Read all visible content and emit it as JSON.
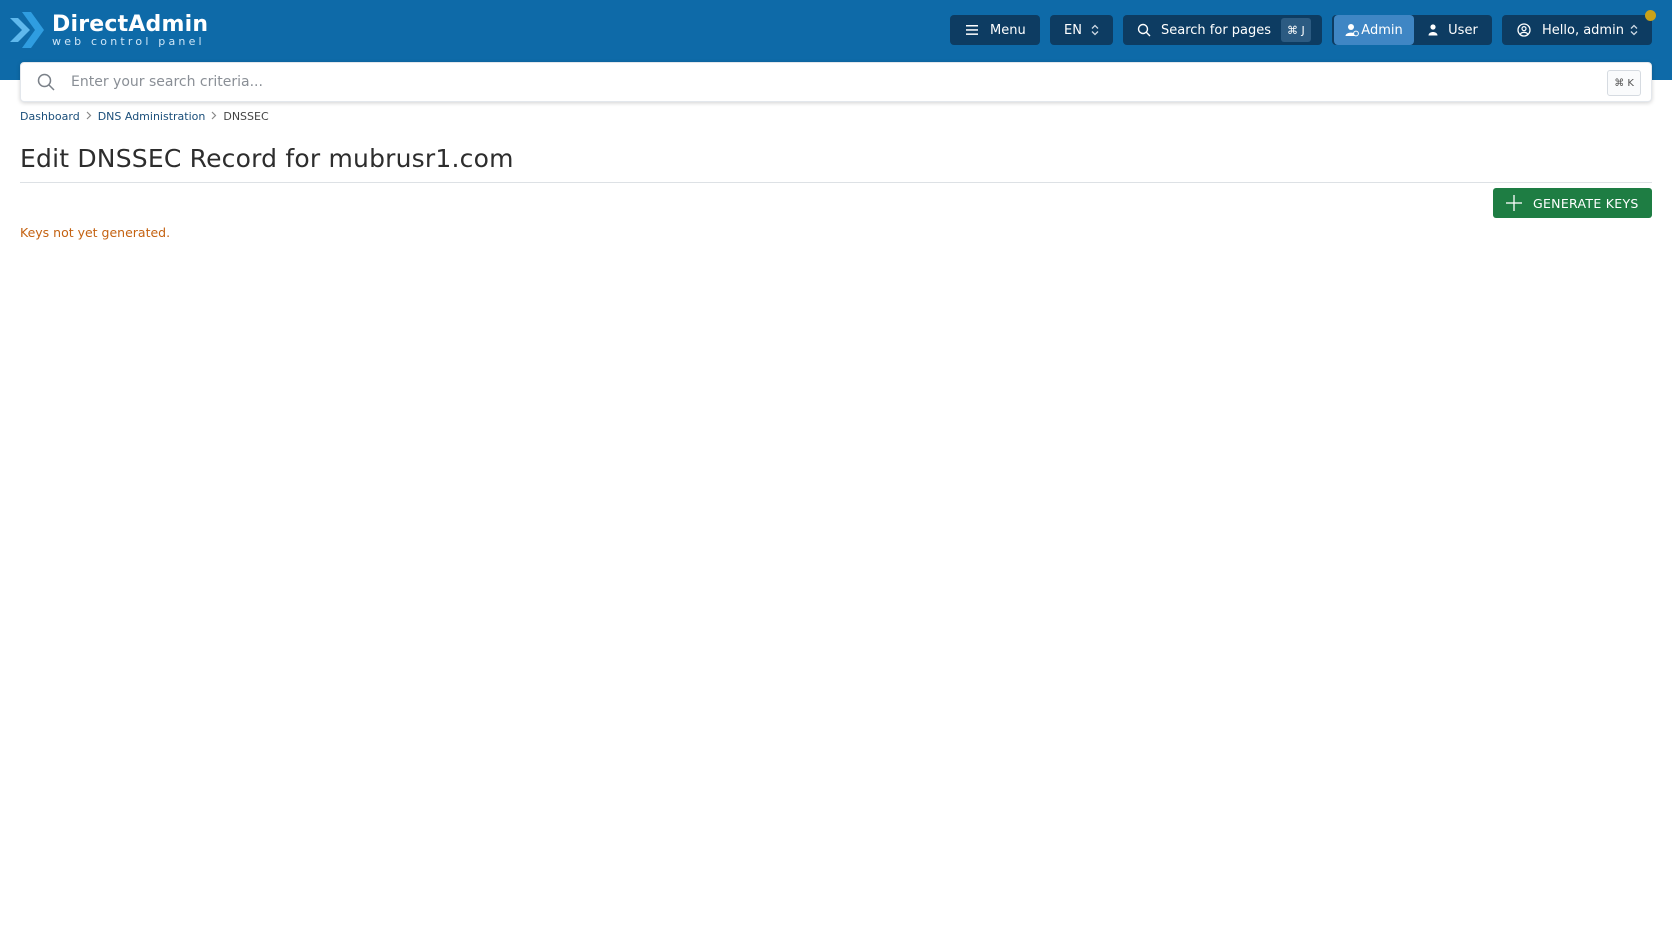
{
  "header": {
    "brand": "DirectAdmin",
    "brand_sub": "web control panel",
    "menu_label": "Menu",
    "language": "EN",
    "search_pages_label": "Search for pages",
    "search_pages_shortcut": "⌘ J",
    "mode_admin": "Admin",
    "mode_user": "User",
    "greeting": "Hello, admin",
    "notification_color": "#c9a21a"
  },
  "search": {
    "placeholder": "Enter your search criteria...",
    "value": "",
    "shortcut": "⌘ K"
  },
  "breadcrumb": {
    "items": [
      "Dashboard",
      "DNS Administration",
      "DNSSEC"
    ]
  },
  "page": {
    "title": "Edit DNSSEC Record for mubrusr1.com",
    "generate_keys_label": "GENERATE KEYS",
    "status_message": "Keys not yet generated."
  },
  "colors": {
    "header_bg": "#0e6aa8",
    "button_dark": "#0d3c62",
    "admin_active": "#3f86c4",
    "primary_green": "#1e7d43",
    "warning_text": "#c46211"
  }
}
